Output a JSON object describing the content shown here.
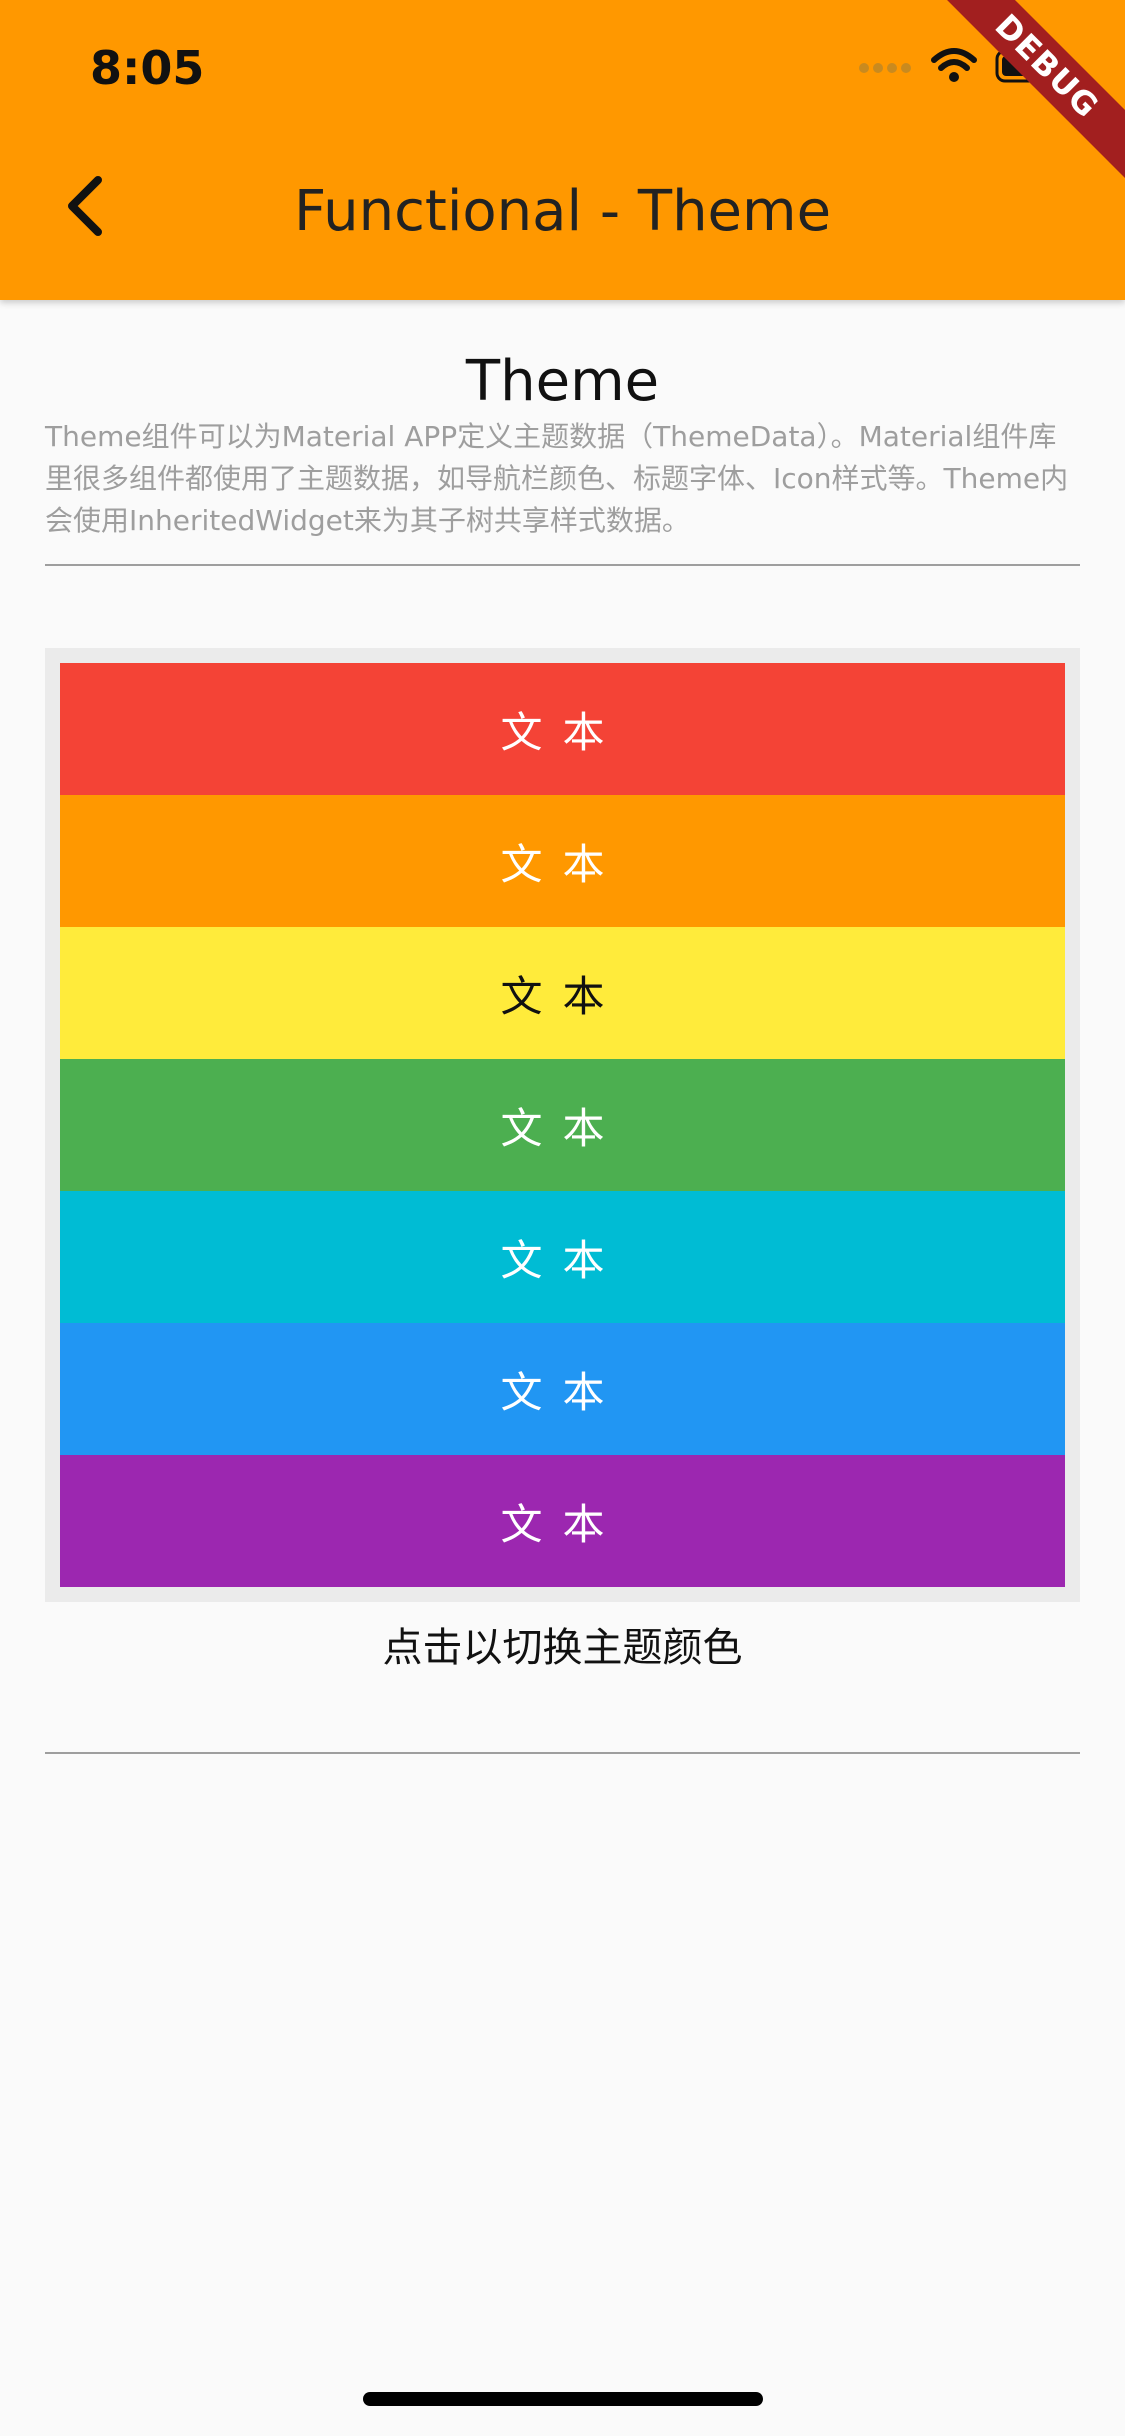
{
  "status": {
    "time": "8:05",
    "debug_label": "DEBUG"
  },
  "appbar": {
    "title": "Functional - Theme",
    "background": "#ff9800"
  },
  "section": {
    "title": "Theme",
    "description": "Theme组件可以为Material APP定义主题数据（ThemeData）。Material组件库里很多组件都使用了主题数据，如导航栏颜色、标题字体、Icon样式等。Theme内会使用InheritedWidget来为其子树共享样式数据。"
  },
  "theme_rows": [
    {
      "label": "文本",
      "color": "#f44336",
      "text_color": "#ffffff"
    },
    {
      "label": "文本",
      "color": "#ff9800",
      "text_color": "#ffffff"
    },
    {
      "label": "文本",
      "color": "#ffeb3b",
      "text_color": "#111111"
    },
    {
      "label": "文本",
      "color": "#4caf50",
      "text_color": "#ffffff"
    },
    {
      "label": "文本",
      "color": "#00bcd4",
      "text_color": "#ffffff"
    },
    {
      "label": "文本",
      "color": "#2196f3",
      "text_color": "#ffffff"
    },
    {
      "label": "文本",
      "color": "#9c27b0",
      "text_color": "#ffffff"
    }
  ],
  "hint": "点击以切换主题颜色",
  "icons": [
    "back-arrow-icon",
    "signal-icon",
    "wifi-icon",
    "battery-icon"
  ]
}
